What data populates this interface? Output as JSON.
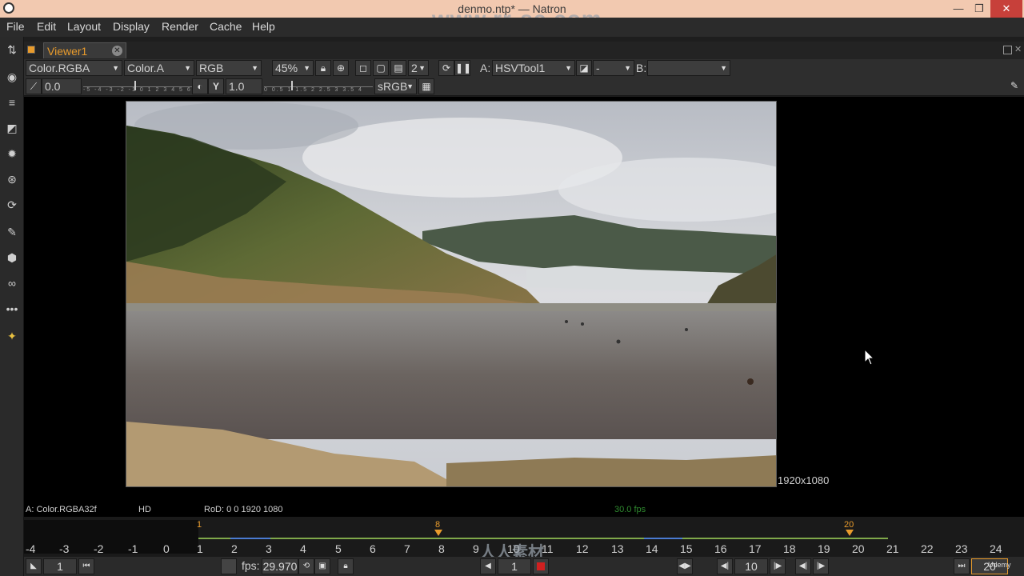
{
  "window": {
    "title": "denmo.ntp* — Natron",
    "minimize": "—",
    "maximize": "❐",
    "close": "✕"
  },
  "watermark": "www.rr-sc.com",
  "menu": [
    "File",
    "Edit",
    "Layout",
    "Display",
    "Render",
    "Cache",
    "Help"
  ],
  "viewer_tab": {
    "label": "Viewer1",
    "close": "✕"
  },
  "controls": {
    "layer": "Color.RGBA",
    "alpha_channel": "Color.A",
    "display_channels": "RGB",
    "zoom": "45%",
    "proxy_level": "2",
    "input_a_label": "A:",
    "input_a": "HSVTool1",
    "operation": "-",
    "input_b_label": "B:",
    "input_b": "",
    "gain_value": "0.0",
    "gain_ticks": "-5 -4 -3 -2 -1 0 1 2 3 4 5 6",
    "gamma_label": "Y",
    "gamma_value": "1.0",
    "gamma_ticks": "0  0.5  1  1.5  2  2.5  3  3.5  4",
    "colorspace": "sRGB"
  },
  "viewer": {
    "resolution": "1920x1080"
  },
  "info": {
    "channel": "A: Color.RGBA32f",
    "format": "HD",
    "rod": "RoD: 0 0 1920 1080",
    "fps": "30.0 fps"
  },
  "timeline": {
    "labels": [
      "-4",
      "-3",
      "-2",
      "-1",
      "0",
      "1",
      "2",
      "3",
      "4",
      "5",
      "6",
      "7",
      "8",
      "9",
      "10",
      "11",
      "12",
      "13",
      "14",
      "15",
      "16",
      "17",
      "18",
      "19",
      "20",
      "21",
      "22",
      "23",
      "24"
    ],
    "in_marker": "1",
    "current_marker": "8",
    "out_marker": "20",
    "watermark": "人人素材"
  },
  "playback": {
    "first_frame": "1",
    "fps_label": "fps:",
    "fps_value": "29.970",
    "current_frame": "1",
    "increment": "10",
    "last_frame": "20",
    "udemy": "Udemy"
  }
}
